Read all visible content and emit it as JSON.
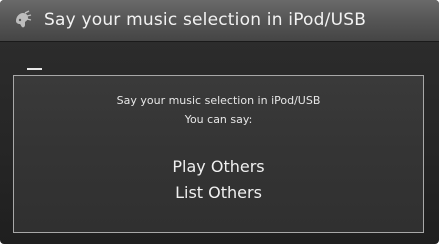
{
  "header": {
    "title": "Say your music selection in iPod/USB",
    "icon": "voice-command-icon"
  },
  "panel": {
    "prompt_line1": "Say your music selection in iPod/USB",
    "prompt_line2": "You can say:",
    "commands": [
      "Play Others",
      "List Others"
    ]
  }
}
